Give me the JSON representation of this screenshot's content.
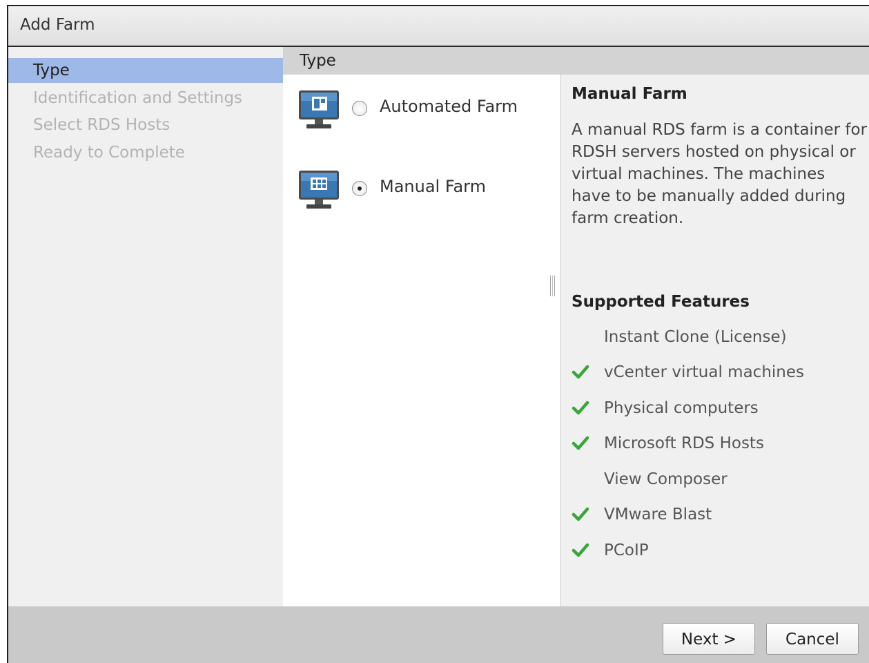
{
  "dialog": {
    "title": "Add Farm"
  },
  "sidebar": {
    "items": [
      {
        "label": "Type",
        "active": true
      },
      {
        "label": "Identification and Settings",
        "active": false
      },
      {
        "label": "Select RDS Hosts",
        "active": false
      },
      {
        "label": "Ready to Complete",
        "active": false
      }
    ]
  },
  "content": {
    "header": "Type",
    "options": [
      {
        "label": "Automated Farm",
        "selected": false,
        "icon": "automated-farm-monitor-icon"
      },
      {
        "label": "Manual Farm",
        "selected": true,
        "icon": "manual-farm-monitor-icon"
      }
    ]
  },
  "details": {
    "title": "Manual Farm",
    "description": "A manual RDS farm is a container for RDSH servers hosted on physical or virtual machines. The machines have to be manually added during farm creation.",
    "features_title": "Supported Features",
    "features": [
      {
        "label": "Instant Clone (License)",
        "supported": false
      },
      {
        "label": "vCenter virtual machines",
        "supported": true
      },
      {
        "label": "Physical computers",
        "supported": true
      },
      {
        "label": "Microsoft RDS Hosts",
        "supported": true
      },
      {
        "label": "View Composer",
        "supported": false
      },
      {
        "label": "VMware Blast",
        "supported": true
      },
      {
        "label": "PCoIP",
        "supported": true
      }
    ]
  },
  "footer": {
    "next_label": "Next >",
    "cancel_label": "Cancel"
  },
  "colors": {
    "active_item": "#9eb8e8",
    "check": "#3aa63a",
    "monitor": "#3a6e9e"
  }
}
